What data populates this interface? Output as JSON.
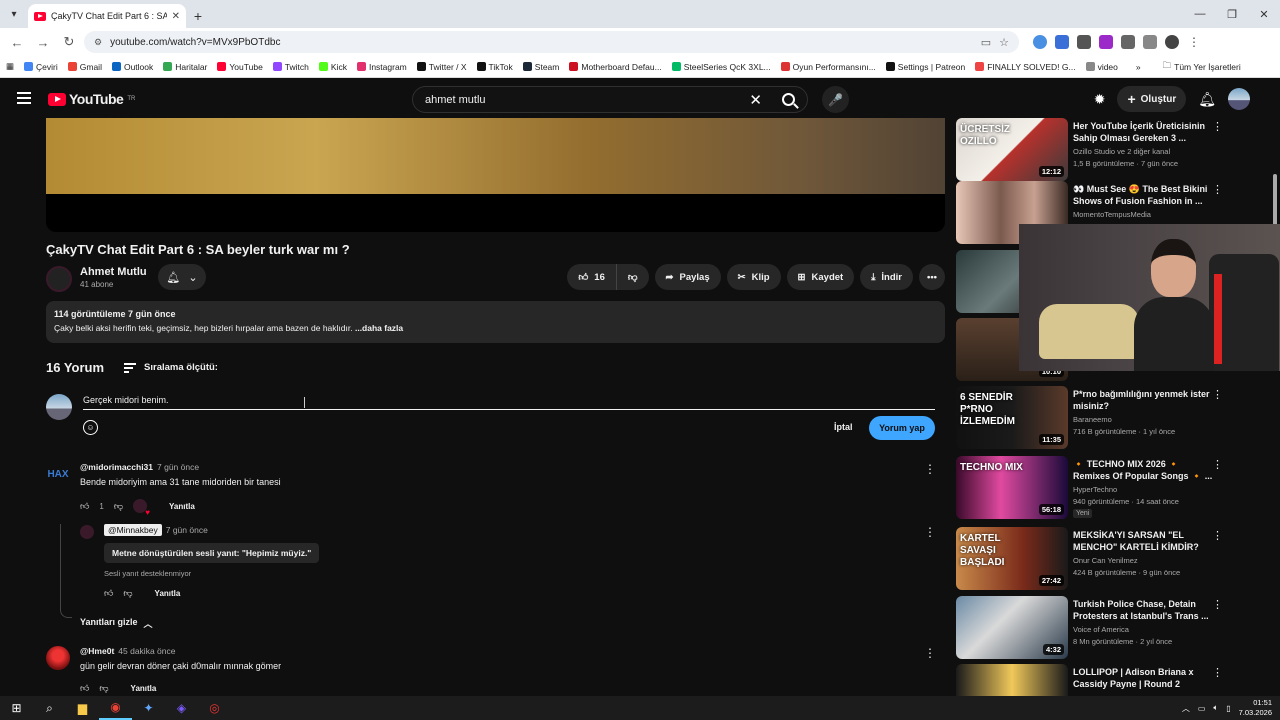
{
  "browser": {
    "tab_title": "ÇakyTV Chat Edit Part 6 : SA be...",
    "url": "youtube.com/watch?v=MVx9PbOTdbc",
    "bookmarks": [
      "Çeviri",
      "Gmail",
      "Outlook",
      "Haritalar",
      "YouTube",
      "Twitch",
      "Kick",
      "Instagram",
      "Twitter / X",
      "TikTok",
      "Steam",
      "Motherboard Defau...",
      "SteelSeries QcK 3XL...",
      "Oyun Performansını...",
      "Settings | Patreon",
      "FINALLY SOLVED! G...",
      "video"
    ],
    "all_bookmarks": "Tüm Yer İşaretleri",
    "colors": {
      "bookmark_icons": [
        "#4285f4",
        "#ea4335",
        "#0a66c2",
        "#34a853",
        "#ff0033",
        "#9146ff",
        "#53fc18",
        "#e1306c",
        "#111111",
        "#111111",
        "#1b2838",
        "#cc1122",
        "#0b6",
        "#d33",
        "#111",
        "#e44",
        "#888"
      ]
    }
  },
  "header": {
    "logo_text": "YouTube",
    "logo_sup": "TR",
    "search_value": "ahmet mutlu",
    "create_label": "Oluştur"
  },
  "video": {
    "title": "ÇakyTV Chat Edit Part 6 : SA beyler turk war mı ?",
    "channel": "Ahmet Mutlu",
    "subscribers": "41 abone",
    "likes": "16",
    "share": "Paylaş",
    "clip": "Klip",
    "save": "Kaydet",
    "download": "İndir",
    "views_date": "114 görüntüleme  7 gün önce",
    "description": "Çaky belki aksi herifin teki, geçimsiz, hep bizleri  hırpalar ama bazen de haklıdır.",
    "more": "...daha fazla"
  },
  "comments": {
    "count": "16 Yorum",
    "sort": "Sıralama ölçütü:",
    "draft": "Gerçek midori benim.",
    "cancel": "İptal",
    "submit": "Yorum yap",
    "reply_label": "Yanıtla",
    "items": [
      {
        "user": "@midorimacchi31",
        "when": "7 gün önce",
        "text": "Bende midoriyim ama 31 tane midoriden bir tanesi",
        "likes": "1",
        "avatar_text": "HAX"
      },
      {
        "user": "@Minnakbey",
        "when": "7 gün önce",
        "voice": "Metne dönüştürülen sesli yanıt: \"Hepimiz müyiz.\"",
        "voice_note": "Sesli yanıt desteklenmiyor"
      },
      {
        "user": "@Hme0t",
        "when": "45 dakika önce",
        "text": "gün gelir devran döner çaki d0malır mınnak gömer"
      }
    ],
    "hide_replies": "Yanıtları gizle"
  },
  "sidebar": [
    {
      "title": "Her YouTube İçerik Üreticisinin Sahip Olması Gereken 3 ...",
      "channel": "Ozillo Studio ve 2 diğer kanal",
      "views": "1,5 B görüntüleme · 7 gün önce",
      "duration": "12:12",
      "thumb_text": "ÜCRETSİZ OZILLO"
    },
    {
      "title": "👀 Must See 😍 The Best Bikini Shows of Fusion Fashion in ...",
      "channel": "MomentoTempusMedia",
      "views": "",
      "duration": ""
    },
    {
      "title": "",
      "channel": "",
      "views": "",
      "duration": ""
    },
    {
      "title": "",
      "channel": "",
      "views": "",
      "duration": "10:10"
    },
    {
      "title": "P*rno bağımlılığını yenmek ister misiniz?",
      "channel": "Baraneemo",
      "views": "716 B görüntüleme · 1 yıl önce",
      "duration": "11:35",
      "thumb_text": "6 SENEDİR P*RNO İZLEMEDİM"
    },
    {
      "title": "🔸 TECHNO MIX 2026 🔸 Remixes Of Popular Songs 🔸 ...",
      "channel": "HyperTechno",
      "views": "940 görüntüleme · 14 saat önce",
      "duration": "56:18",
      "badge": "Yeni",
      "thumb_text": "TECHNO MIX"
    },
    {
      "title": "MEKSİKA'YI SARSAN \"EL MENCHO\" KARTELİ KİMDİR?",
      "channel": "Onur Can Yenilmez",
      "views": "424 B görüntüleme · 9 gün önce",
      "duration": "27:42",
      "thumb_text": "KARTEL SAVAŞI BAŞLADI"
    },
    {
      "title": "Turkish Police Chase, Detain Protesters at Istanbul's Trans ...",
      "channel": "Voice of America",
      "views": "8 Mn görüntüleme · 2 yıl önce",
      "duration": "4:32"
    },
    {
      "title": "LOLLIPOP | Adison Briana x Cassidy Payne | Round 2",
      "channel": "",
      "views": "",
      "duration": ""
    }
  ],
  "taskbar": {
    "time": "01:51",
    "date": "7.03.2026"
  }
}
